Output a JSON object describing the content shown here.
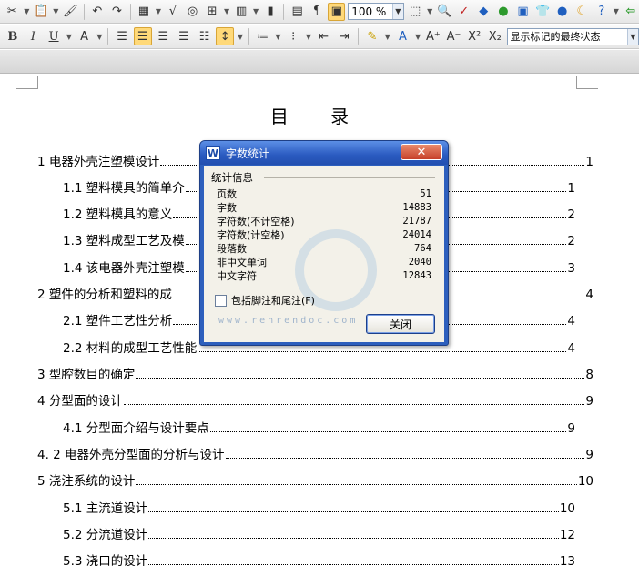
{
  "toolbar": {
    "zoom_value": "100 %",
    "markup_state": "显示标记的最终状态",
    "bold_label": "B",
    "italic_label": "I",
    "underline_label": "U"
  },
  "document": {
    "title": "目 录",
    "toc": [
      {
        "label": "1 电器外壳注塑模设计",
        "page": "1"
      },
      {
        "label": "1.1 塑料模具的简单介",
        "page": "1"
      },
      {
        "label": "1.2 塑料模具的意义",
        "page": "2"
      },
      {
        "label": "1.3 塑料成型工艺及模",
        "page": "2"
      },
      {
        "label": "1.4 该电器外壳注塑模",
        "page": "3"
      },
      {
        "label": "2  塑件的分析和塑料的成",
        "page": "4"
      },
      {
        "label": "2.1 塑件工艺性分析",
        "page": "4"
      },
      {
        "label": "2.2 材料的成型工艺性能",
        "page": "4"
      },
      {
        "label": "3 型腔数目的确定",
        "page": "8"
      },
      {
        "label": "4  分型面的设计",
        "page": "9"
      },
      {
        "label": "4.1 分型面介绍与设计要点",
        "page": "9"
      },
      {
        "label": "4. 2 电器外壳分型面的分析与设计",
        "page": "9"
      },
      {
        "label": "5  浇注系统的设计",
        "page": "10"
      },
      {
        "label": "5.1 主流道设计",
        "page": "10"
      },
      {
        "label": "5.2  分流道设计",
        "page": "12"
      },
      {
        "label": "5.3  浇口的设计",
        "page": "13"
      }
    ]
  },
  "dialog": {
    "title": "字数统计",
    "close_symbol": "✕",
    "group_label": "统计信息",
    "stats": [
      {
        "label": "页数",
        "value": "51"
      },
      {
        "label": "字数",
        "value": "14883"
      },
      {
        "label": "字符数(不计空格)",
        "value": "21787"
      },
      {
        "label": "字符数(计空格)",
        "value": "24014"
      },
      {
        "label": "段落数",
        "value": "764"
      },
      {
        "label": "非中文单词",
        "value": "2040"
      },
      {
        "label": "中文字符",
        "value": "12843"
      }
    ],
    "checkbox_label": "包括脚注和尾注(F)",
    "close_button": "关闭"
  },
  "watermark": {
    "url_text": "www.renrendoc.com"
  }
}
